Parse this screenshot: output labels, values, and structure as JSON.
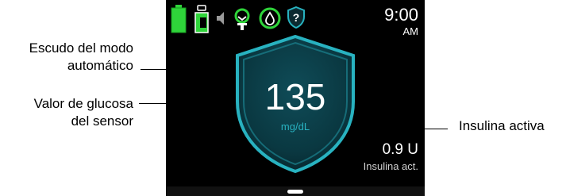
{
  "annotations": {
    "shield_line1": "Escudo del modo",
    "shield_line2": "automático",
    "glucose_line1": "Valor de glucosa",
    "glucose_line2": "del sensor",
    "active_insulin": "Insulina activa"
  },
  "status_bar": {
    "time": "9:00",
    "ampm": "AM",
    "icons": [
      "battery-icon",
      "insulin-cartridge-icon",
      "volume-icon",
      "cgm-sensor-icon",
      "drop-icon",
      "help-icon"
    ],
    "help_glyph": "?"
  },
  "main": {
    "glucose_value": "135",
    "glucose_unit": "mg/dL",
    "iob_value": "0.9 U",
    "iob_label": "Insulina act."
  },
  "colors": {
    "battery": "#2fd43a",
    "green_ring": "#2fd43a",
    "accent_cyan": "#28b2c0",
    "screen_bg": "#000000"
  }
}
